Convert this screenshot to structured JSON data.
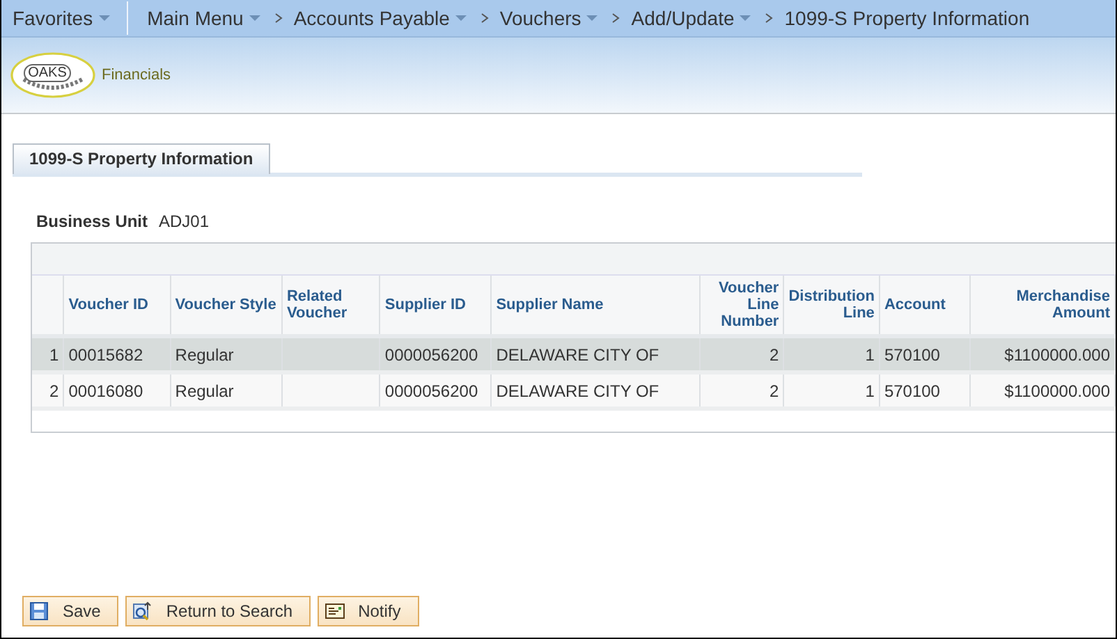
{
  "nav": {
    "items": [
      {
        "label": "Favorites",
        "dropdown": true
      },
      {
        "label": "Main Menu",
        "dropdown": true
      },
      {
        "label": "Accounts Payable",
        "dropdown": true
      },
      {
        "label": "Vouchers",
        "dropdown": true
      },
      {
        "label": "Add/Update",
        "dropdown": true
      },
      {
        "label": "1099-S Property Information",
        "dropdown": false
      }
    ]
  },
  "logo": {
    "mark": "OAKS",
    "text": "Financials"
  },
  "tabs": [
    {
      "label": "1099-S Property Information",
      "selected": true
    }
  ],
  "business_unit": {
    "label": "Business Unit",
    "value": "ADJ01"
  },
  "table": {
    "columns": [
      "",
      "Voucher ID",
      "Voucher Style",
      "Related Voucher",
      "Supplier ID",
      "Supplier Name",
      "Voucher Line Number",
      "Distribution Line",
      "Account",
      "Merchandise Amount"
    ],
    "rows": [
      {
        "selected": true,
        "cells": [
          "1",
          "00015682",
          "Regular",
          "",
          "0000056200",
          "DELAWARE CITY OF",
          "2",
          "1",
          "570100",
          "$1100000.000"
        ]
      },
      {
        "selected": false,
        "cells": [
          "2",
          "00016080",
          "Regular",
          "",
          "0000056200",
          "DELAWARE CITY OF",
          "2",
          "1",
          "570100",
          "$1100000.000"
        ]
      }
    ]
  },
  "buttons": [
    {
      "label": "Save",
      "kind": "save"
    },
    {
      "label": "Return to Search",
      "kind": "search"
    },
    {
      "label": "Notify",
      "kind": "notify"
    }
  ]
}
